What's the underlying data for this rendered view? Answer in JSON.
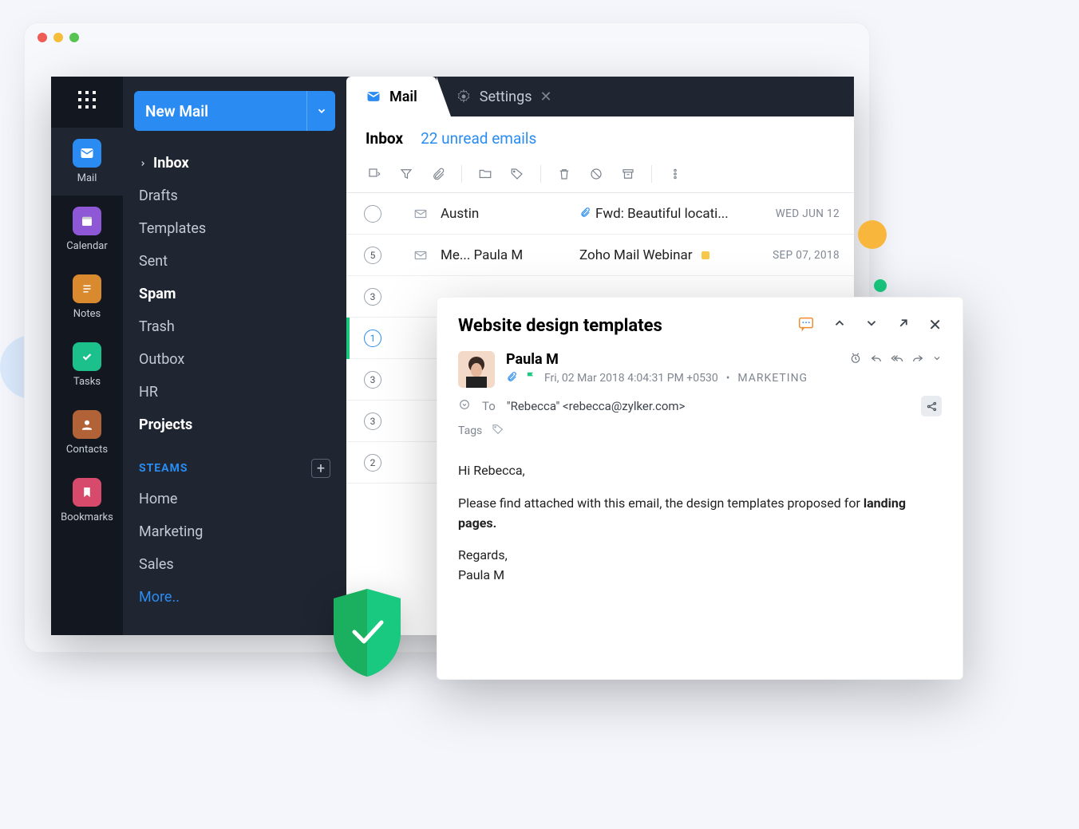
{
  "traffic": {
    "close": "#ee5c54",
    "min": "#f6bd3b",
    "max": "#57c353"
  },
  "rail": {
    "items": [
      {
        "label": "Mail",
        "bg": "#2a8cf2"
      },
      {
        "label": "Calendar",
        "bg": "#8e57d6"
      },
      {
        "label": "Notes",
        "bg": "#d98a2e"
      },
      {
        "label": "Tasks",
        "bg": "#1bc08b"
      },
      {
        "label": "Contacts",
        "bg": "#b16236"
      },
      {
        "label": "Bookmarks",
        "bg": "#d84a6c"
      }
    ]
  },
  "nav": {
    "new_label": "New Mail",
    "folders": [
      {
        "label": "Inbox",
        "bold": true,
        "chevron": true
      },
      {
        "label": "Drafts"
      },
      {
        "label": "Templates"
      },
      {
        "label": "Sent"
      },
      {
        "label": "Spam",
        "bold": true
      },
      {
        "label": "Trash"
      },
      {
        "label": "Outbox"
      },
      {
        "label": "HR"
      },
      {
        "label": "Projects",
        "bold": true
      }
    ],
    "streams_header": "STEAMS",
    "streams": [
      {
        "label": "Home"
      },
      {
        "label": "Marketing"
      },
      {
        "label": "Sales"
      },
      {
        "label": "More..",
        "link": true
      }
    ]
  },
  "tabs": {
    "mail": "Mail",
    "settings": "Settings"
  },
  "header": {
    "h1": "Inbox",
    "unread": "22 unread emails"
  },
  "rows": [
    {
      "badge": "",
      "from": "Austin",
      "clip": true,
      "subject": "Fwd: Beautiful locati...",
      "date": "WED JUN 12"
    },
    {
      "badge": "5",
      "from": "Me... Paula M",
      "clip": false,
      "subject": "Zoho Mail Webinar",
      "date": "SEP 07, 2018",
      "dot": true
    },
    {
      "badge": "3"
    },
    {
      "badge": "1",
      "selected": true
    },
    {
      "badge": "3"
    },
    {
      "badge": "3"
    },
    {
      "badge": "2"
    }
  ],
  "preview": {
    "title": "Website design templates",
    "sender": "Paula M",
    "timestamp": "Fri, 02 Mar 2018 4:04:31 PM +0530",
    "category": "MARKETING",
    "to_label": "To",
    "to_value": "\"Rebecca\" <rebecca@zylker.com>",
    "tags_label": "Tags",
    "body_greeting": "Hi Rebecca,",
    "body_line1_a": "Please find attached with this email, the design templates proposed for ",
    "body_line1_b": "landing pages.",
    "body_regards": "Regards,",
    "body_signature": "Paula M"
  }
}
